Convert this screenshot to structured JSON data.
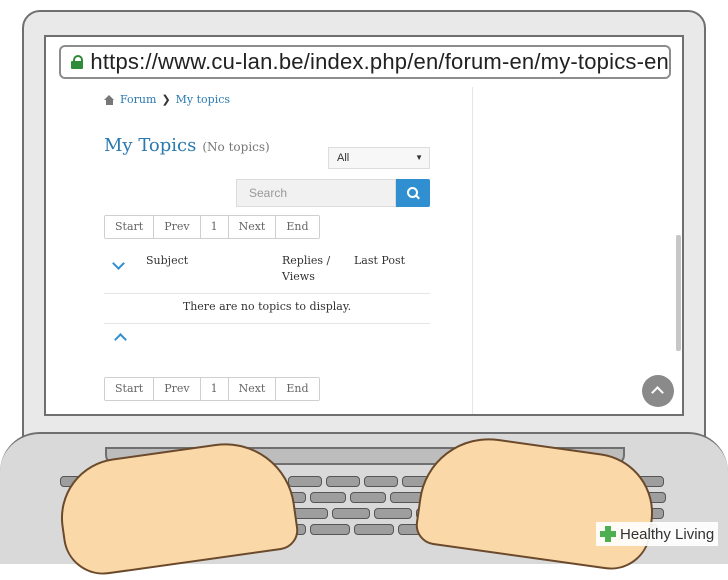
{
  "browser": {
    "url": "https://www.cu-lan.be/index.php/en/forum-en/my-topics-en"
  },
  "breadcrumb": {
    "items": [
      "Forum",
      "My topics"
    ]
  },
  "page": {
    "title": "My Topics",
    "subtitle": "(No topics)",
    "filter_value": "All",
    "search_placeholder": "Search"
  },
  "pagination": {
    "start": "Start",
    "prev": "Prev",
    "page": "1",
    "next": "Next",
    "end": "End"
  },
  "table": {
    "col_subject": "Subject",
    "col_replies_line1": "Replies /",
    "col_replies_line2": "Views",
    "col_last_post": "Last Post",
    "empty_message": "There are no topics to display."
  },
  "watermark": {
    "text": "Healthy Living"
  },
  "colors": {
    "accent": "#2f8fd1",
    "link": "#2a7ab0",
    "lock": "#2e8b3a"
  }
}
